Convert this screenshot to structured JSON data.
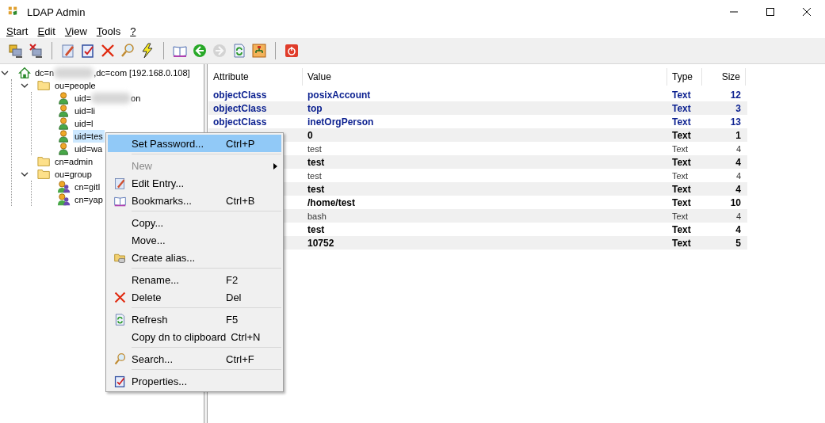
{
  "window": {
    "title": "LDAP Admin"
  },
  "menu_bar": [
    "Start",
    "Edit",
    "View",
    "Tools",
    "?"
  ],
  "toolbar": [
    {
      "kind": "connect",
      "disabled": false
    },
    {
      "kind": "disconnect",
      "disabled": false
    },
    {
      "kind": "sep"
    },
    {
      "kind": "edit",
      "disabled": false
    },
    {
      "kind": "properties",
      "disabled": false
    },
    {
      "kind": "delete",
      "disabled": false
    },
    {
      "kind": "search",
      "disabled": false
    },
    {
      "kind": "lightning",
      "disabled": false
    },
    {
      "kind": "sep"
    },
    {
      "kind": "book",
      "disabled": false
    },
    {
      "kind": "back",
      "disabled": false
    },
    {
      "kind": "forward",
      "disabled": true
    },
    {
      "kind": "refresh",
      "disabled": false
    },
    {
      "kind": "tree",
      "disabled": false
    },
    {
      "kind": "sep"
    },
    {
      "kind": "power",
      "disabled": false
    }
  ],
  "tree": [
    {
      "kind": "server",
      "labels": [
        "dc=n",
        ",dc=com [192.168.0.108]"
      ],
      "expanded": true,
      "selected": false,
      "children": [
        {
          "kind": "folder",
          "labels": [
            "ou=people"
          ],
          "expanded": true,
          "selected": false,
          "children": [
            {
              "kind": "user",
              "labels": [
                "uid=",
                "on"
              ],
              "selected": false
            },
            {
              "kind": "user",
              "labels": [
                "uid=li"
              ],
              "selected": false
            },
            {
              "kind": "user",
              "labels": [
                "uid=l"
              ],
              "selected": false
            },
            {
              "kind": "user",
              "labels": [
                "uid=tes"
              ],
              "selected": true
            },
            {
              "kind": "user",
              "labels": [
                "uid=wa"
              ],
              "selected": false
            }
          ]
        },
        {
          "kind": "folder",
          "labels": [
            "cn=admin"
          ],
          "selected": false
        },
        {
          "kind": "folder",
          "labels": [
            "ou=group"
          ],
          "expanded": true,
          "selected": false,
          "children": [
            {
              "kind": "group",
              "labels": [
                "cn=gitl"
              ],
              "selected": false
            },
            {
              "kind": "group",
              "labels": [
                "cn=yap"
              ],
              "selected": false
            }
          ]
        }
      ]
    }
  ],
  "table": {
    "columns": [
      "Attribute",
      "Value",
      "Type",
      "Size"
    ],
    "rows": [
      {
        "kind": "class",
        "attribute": "objectClass",
        "value": "posixAccount",
        "type": "Text",
        "size": "12"
      },
      {
        "kind": "class",
        "attribute": "objectClass",
        "value": "top",
        "type": "Text",
        "size": "3"
      },
      {
        "kind": "class",
        "attribute": "objectClass",
        "value": "inetOrgPerson",
        "type": "Text",
        "size": "13"
      },
      {
        "kind": "bold",
        "value": "0",
        "type": "Text",
        "size": "1"
      },
      {
        "kind": "plain",
        "value": "test",
        "type": "Text",
        "size": "4"
      },
      {
        "kind": "bold",
        "value": "test",
        "type": "Text",
        "size": "4"
      },
      {
        "kind": "plain",
        "value": "test",
        "type": "Text",
        "size": "4"
      },
      {
        "kind": "bold",
        "value": "test",
        "type": "Text",
        "size": "4"
      },
      {
        "kind": "bold",
        "value": "/home/test",
        "type": "Text",
        "size": "10"
      },
      {
        "kind": "plain",
        "value": "bash",
        "type": "Text",
        "size": "4"
      },
      {
        "kind": "bold",
        "value": "test",
        "type": "Text",
        "size": "4"
      },
      {
        "kind": "bold",
        "value": "10752",
        "type": "Text",
        "size": "5"
      }
    ]
  },
  "context_menu": [
    {
      "kind": "plain",
      "label": "Set Password...",
      "shortcut": "Ctrl+P",
      "selected": true,
      "disabled": false
    },
    {
      "kind": "separator"
    },
    {
      "kind": "submenu",
      "label": "New",
      "selected": false,
      "disabled": true
    },
    {
      "kind": "edit",
      "label": "Edit Entry...",
      "selected": false,
      "disabled": false
    },
    {
      "kind": "book",
      "label": "Bookmarks...",
      "shortcut": "Ctrl+B",
      "selected": false,
      "disabled": false
    },
    {
      "kind": "separator"
    },
    {
      "kind": "plain",
      "label": "Copy...",
      "selected": false,
      "disabled": false
    },
    {
      "kind": "plain",
      "label": "Move...",
      "selected": false,
      "disabled": false
    },
    {
      "kind": "alias",
      "label": "Create alias...",
      "selected": false,
      "disabled": false
    },
    {
      "kind": "separator"
    },
    {
      "kind": "plain",
      "label": "Rename...",
      "shortcut": "F2",
      "selected": false,
      "disabled": false
    },
    {
      "kind": "delete",
      "label": "Delete",
      "shortcut": "Del",
      "selected": false,
      "disabled": false
    },
    {
      "kind": "separator"
    },
    {
      "kind": "refresh",
      "label": "Refresh",
      "shortcut": "F5",
      "selected": false,
      "disabled": false
    },
    {
      "kind": "plain",
      "label": "Copy dn to clipboard",
      "shortcut": "Ctrl+N",
      "selected": false,
      "disabled": false
    },
    {
      "kind": "separator"
    },
    {
      "kind": "search",
      "label": "Search...",
      "shortcut": "Ctrl+F",
      "selected": false,
      "disabled": false
    },
    {
      "kind": "separator"
    },
    {
      "kind": "properties",
      "label": "Properties...",
      "selected": false,
      "disabled": false
    }
  ]
}
